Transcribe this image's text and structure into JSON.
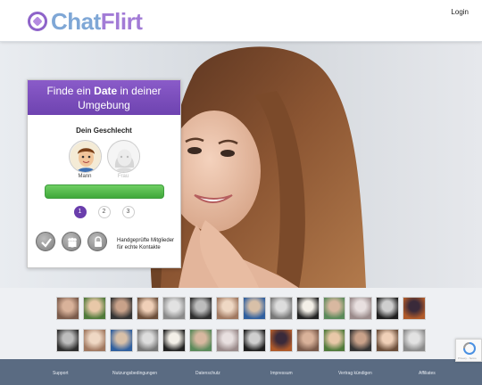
{
  "header": {
    "logo_part1": "Chat",
    "logo_part2": "Flirt",
    "login_label": "Login"
  },
  "card": {
    "headline_part1": "Finde ein ",
    "headline_bold": "Date",
    "headline_part2": " in deiner Umgebung",
    "gender_title": "Dein Geschlecht",
    "gender_male": "Mann",
    "gender_female": "Frau",
    "steps": [
      "1",
      "2",
      "3"
    ],
    "active_step": 1,
    "badge_text": "Handgeprüfte Mitglieder für echte Kontakte"
  },
  "gallery": {
    "row1_count": 14,
    "row2_count": 14
  },
  "recaptcha": {
    "text": "Privacy - Terms"
  },
  "footer": {
    "links": [
      "Support",
      "Nutzungsbedingungen",
      "Datenschutz",
      "Impressum",
      "Vertrag kündigen",
      "Affiliates"
    ]
  },
  "colors": {
    "brand_purple": "#7a4fbd",
    "cta_green": "#4cb545",
    "footer_bg": "#5a6b82"
  }
}
